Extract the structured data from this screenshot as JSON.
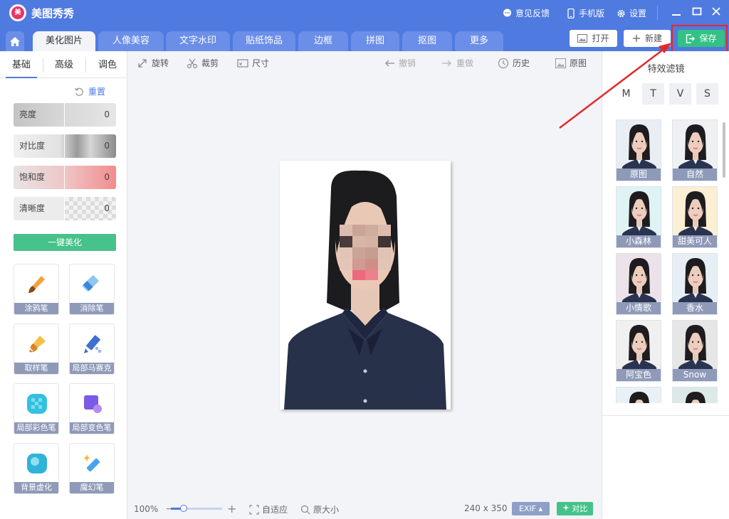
{
  "app": {
    "title": "美图秀秀",
    "logo_text": "美"
  },
  "title_bar": {
    "feedback": "意见反馈",
    "mobile": "手机版",
    "settings": "设置"
  },
  "tabs": [
    "美化图片",
    "人像美容",
    "文字水印",
    "贴纸饰品",
    "边框",
    "拼图",
    "抠图",
    "更多"
  ],
  "actions": {
    "open": "打开",
    "new": "新建",
    "save": "保存"
  },
  "left_panel": {
    "subtabs": [
      "基础",
      "高级",
      "调色"
    ],
    "reset": "重置",
    "sliders": [
      {
        "label": "亮度",
        "value": "0"
      },
      {
        "label": "对比度",
        "value": "0"
      },
      {
        "label": "饱和度",
        "value": "0"
      },
      {
        "label": "清晰度",
        "value": "0"
      }
    ],
    "one_key": "一键美化",
    "tools": [
      "涂鸦笔",
      "消除笔",
      "取样笔",
      "局部马赛克",
      "局部彩色笔",
      "局部变色笔",
      "背景虚化",
      "魔幻笔"
    ]
  },
  "center_toolbar": {
    "rotate": "旋转",
    "crop": "裁剪",
    "size": "尺寸",
    "undo": "撤销",
    "redo": "重做",
    "history": "历史",
    "original": "原图"
  },
  "bottom_bar": {
    "zoom": "100%",
    "zoom_level": 0.25,
    "fit": "自适应",
    "actual_size": "原大小",
    "dimensions": "240 x 350",
    "exif": "EXIF",
    "compare": "对比"
  },
  "right_panel": {
    "title": "特效滤镜",
    "filter_tabs": [
      "M",
      "T",
      "V",
      "S"
    ],
    "filters": [
      "原图",
      "自然",
      "小森林",
      "甜美可人",
      "小情歌",
      "香水",
      "阿宝色",
      "Snow"
    ]
  },
  "colors": {
    "brand": "#4f7ae0",
    "save": "#33c185",
    "highlight": "#e52929"
  }
}
